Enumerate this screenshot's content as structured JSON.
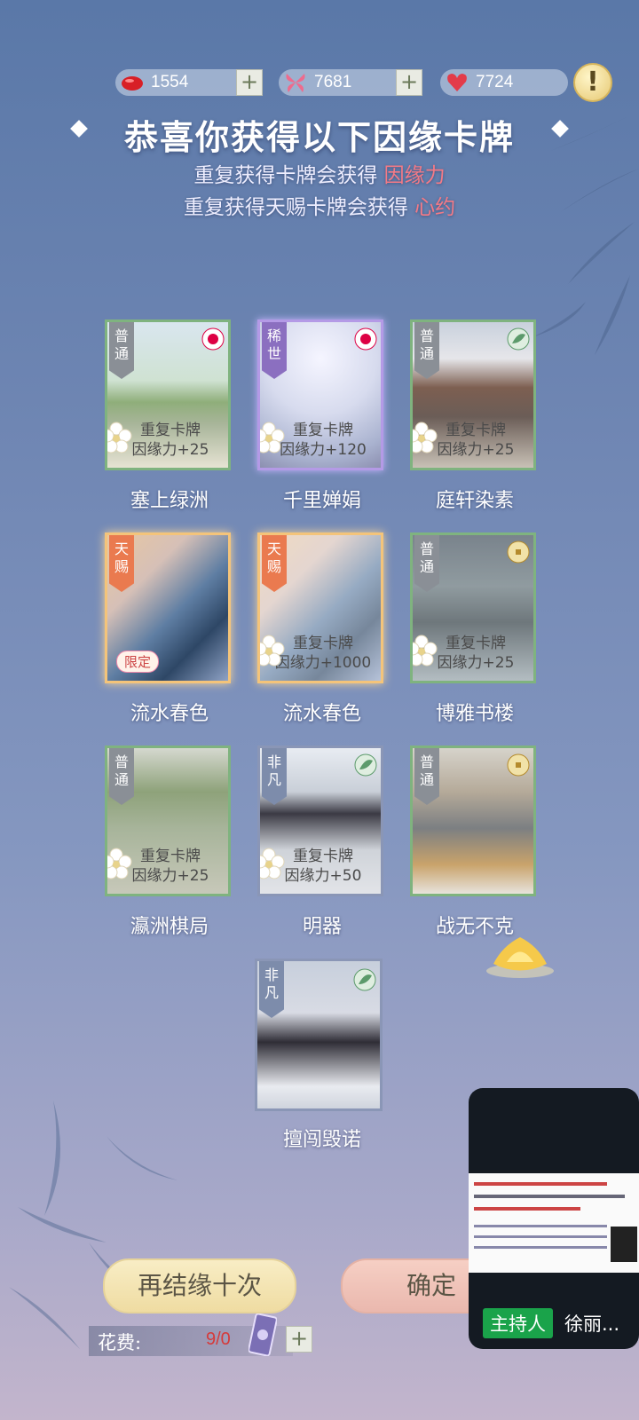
{
  "currency": [
    {
      "name": "red-gem",
      "value": "1554"
    },
    {
      "name": "butterfly",
      "value": "7681"
    },
    {
      "name": "heart",
      "value": "7724"
    }
  ],
  "plus_label": "+",
  "hint_label": "!",
  "title": "恭喜你获得以下因缘卡牌",
  "sub1": {
    "text": "重复获得卡牌会获得 ",
    "highlight": "因缘力"
  },
  "sub2": {
    "text": "重复获得天赐卡牌会获得 ",
    "highlight": "心约"
  },
  "cards": [
    {
      "name": "塞上绿洲",
      "rarity": "普通",
      "dup1": "重复卡牌",
      "dup2": "因缘力+25"
    },
    {
      "name": "千里婵娟",
      "rarity": "稀世",
      "dup1": "重复卡牌",
      "dup2": "因缘力+120"
    },
    {
      "name": "庭轩染素",
      "rarity": "普通",
      "dup1": "重复卡牌",
      "dup2": "因缘力+25"
    },
    {
      "name": "流水春色",
      "rarity": "天赐",
      "badge": "限定"
    },
    {
      "name": "流水春色",
      "rarity": "天赐",
      "dup1": "重复卡牌",
      "dup2": "因缘力+1000"
    },
    {
      "name": "博雅书楼",
      "rarity": "普通",
      "dup1": "重复卡牌",
      "dup2": "因缘力+25"
    },
    {
      "name": "瀛洲棋局",
      "rarity": "普通",
      "dup1": "重复卡牌",
      "dup2": "因缘力+25"
    },
    {
      "name": "明器",
      "rarity": "非凡",
      "dup1": "重复卡牌",
      "dup2": "因缘力+50"
    },
    {
      "name": "战无不克",
      "rarity": "普通"
    },
    {
      "name": "擅闯毁诺",
      "rarity": "非凡"
    }
  ],
  "buttons": {
    "again": "再结缘十次",
    "confirm": "确定"
  },
  "cost": {
    "label": "花费:",
    "value": "9/0"
  },
  "stream": {
    "host_label": "主持人",
    "host_name": "徐丽..."
  }
}
